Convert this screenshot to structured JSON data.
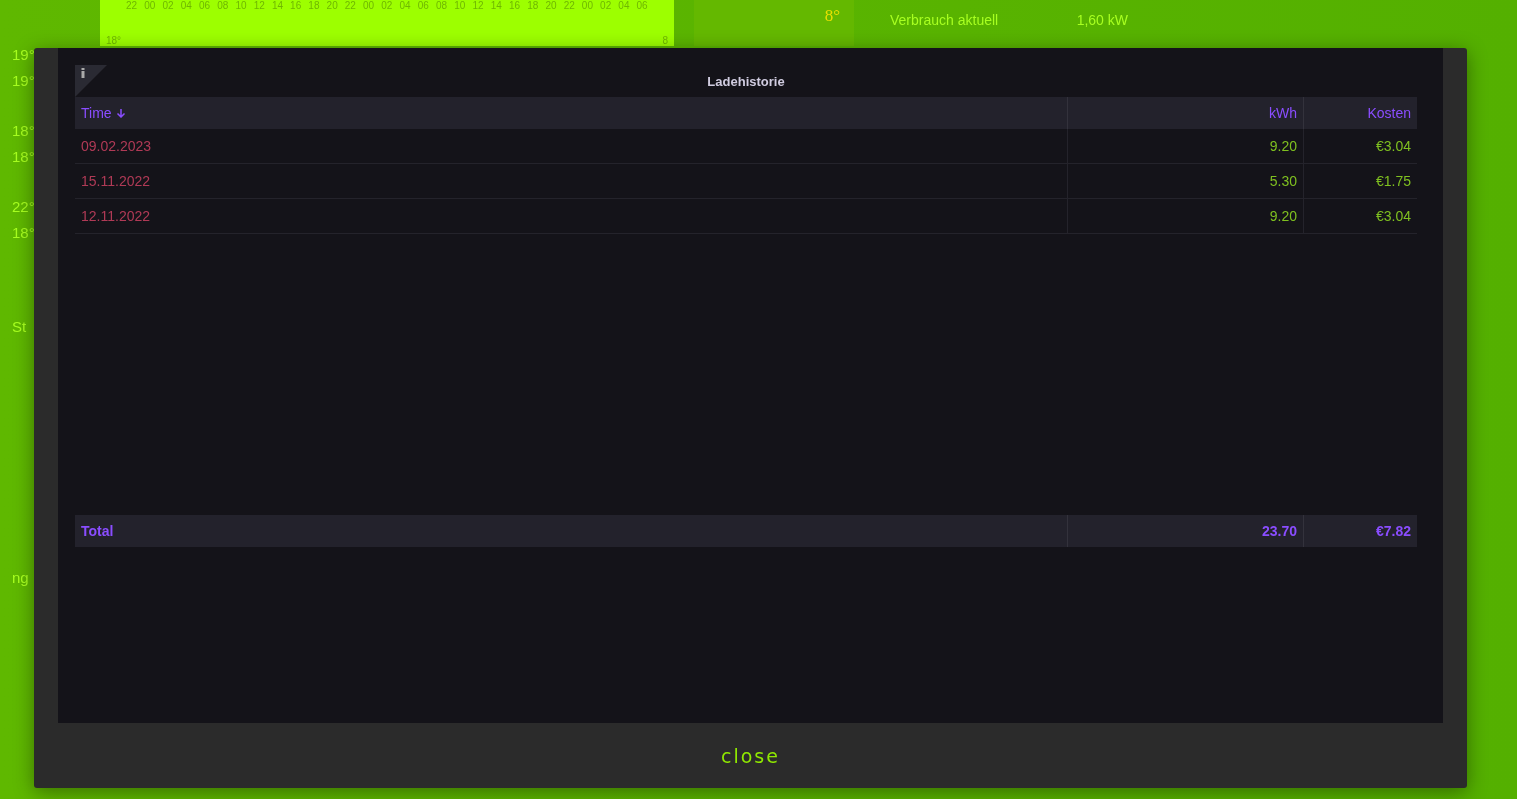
{
  "background": {
    "temps": [
      "19°",
      "19°",
      "18°",
      "18°",
      "22°",
      "18°"
    ],
    "chart": {
      "hours": [
        "22",
        "00",
        "02",
        "04",
        "06",
        "08",
        "10",
        "12",
        "14",
        "16",
        "18",
        "20",
        "22",
        "00",
        "02",
        "04",
        "06",
        "08",
        "10",
        "12",
        "14",
        "16",
        "18",
        "20",
        "22",
        "00",
        "02",
        "04",
        "06"
      ],
      "left_label": "18°",
      "right_label": "8"
    },
    "weather": {
      "temp": "8°"
    },
    "energy": [
      {
        "label": "Verbrauch aktuell",
        "value": "1,60",
        "unit": "kW"
      }
    ],
    "side_labels": [
      "St",
      "ng"
    ]
  },
  "dialog": {
    "title": "Ladehistorie",
    "columns": [
      {
        "label": "Time",
        "sorted": true
      },
      {
        "label": "kWh",
        "sorted": false
      },
      {
        "label": "Kosten",
        "sorted": false
      }
    ],
    "rows": [
      {
        "time": "09.02.2023",
        "kwh": "9.20",
        "cost": "€3.04"
      },
      {
        "time": "15.11.2022",
        "kwh": "5.30",
        "cost": "€1.75"
      },
      {
        "time": "12.11.2022",
        "kwh": "9.20",
        "cost": "€3.04"
      }
    ],
    "total": {
      "label": "Total",
      "kwh": "23.70",
      "cost": "€7.82"
    },
    "close": "close"
  }
}
